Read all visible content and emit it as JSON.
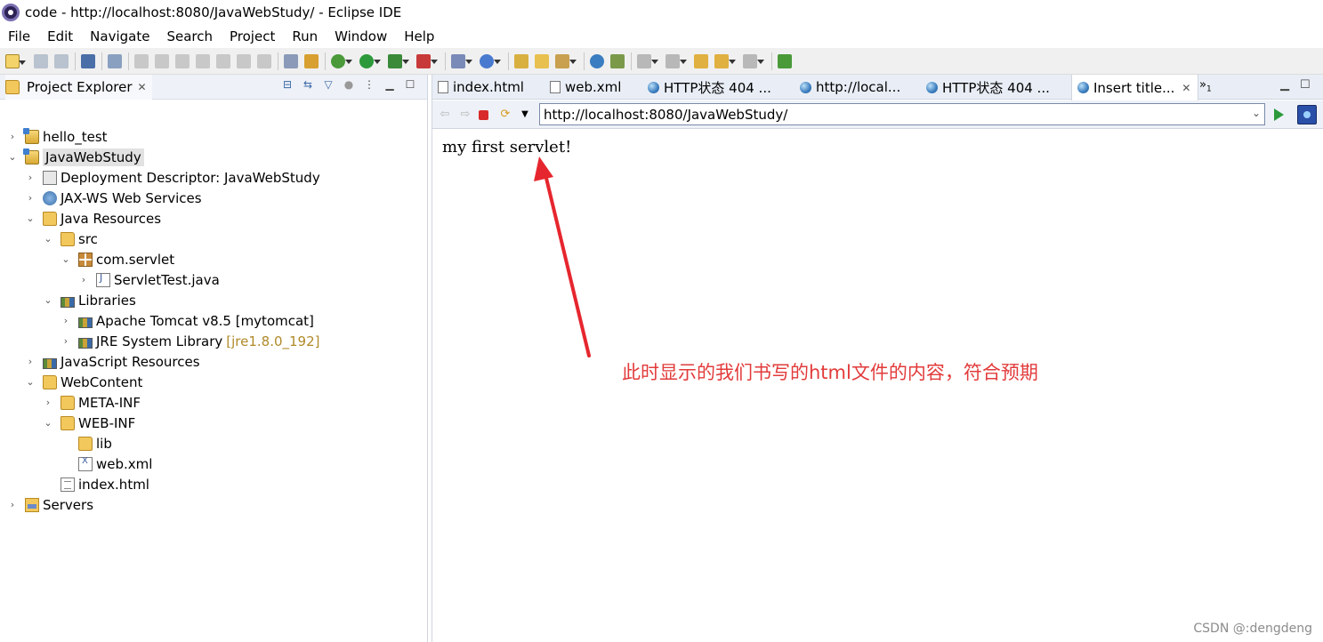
{
  "window": {
    "title": "code - http://localhost:8080/JavaWebStudy/ - Eclipse IDE"
  },
  "menu": [
    "File",
    "Edit",
    "Navigate",
    "Search",
    "Project",
    "Run",
    "Window",
    "Help"
  ],
  "project_explorer": {
    "title": "Project Explorer",
    "tree": [
      {
        "label": "hello_test",
        "icon": "project-icon",
        "expanded": false
      },
      {
        "label": "JavaWebStudy",
        "icon": "project-icon",
        "expanded": true,
        "selected": true
      },
      {
        "label": "Deployment Descriptor: JavaWebStudy",
        "icon": "deployment-descriptor-icon",
        "expanded": false
      },
      {
        "label": "JAX-WS Web Services",
        "icon": "web-services-icon",
        "expanded": false
      },
      {
        "label": "Java Resources",
        "icon": "java-resources-icon",
        "expanded": true
      },
      {
        "label": "src",
        "icon": "source-folder-icon",
        "expanded": true
      },
      {
        "label": "com.servlet",
        "icon": "package-icon",
        "expanded": true
      },
      {
        "label": "ServletTest.java",
        "icon": "java-file-icon",
        "expanded": false
      },
      {
        "label": "Libraries",
        "icon": "libraries-icon",
        "expanded": true
      },
      {
        "label": "Apache Tomcat v8.5 [mytomcat]",
        "icon": "library-icon",
        "expanded": false
      },
      {
        "label": "JRE System Library",
        "decoration": "[jre1.8.0_192]",
        "icon": "library-icon",
        "expanded": false
      },
      {
        "label": "JavaScript Resources",
        "icon": "libraries-icon",
        "expanded": false
      },
      {
        "label": "WebContent",
        "icon": "folder-icon",
        "expanded": true
      },
      {
        "label": "META-INF",
        "icon": "folder-icon",
        "expanded": false
      },
      {
        "label": "WEB-INF",
        "icon": "folder-icon",
        "expanded": true
      },
      {
        "label": "lib",
        "icon": "folder-icon"
      },
      {
        "label": "web.xml",
        "icon": "xml-file-icon"
      },
      {
        "label": "index.html",
        "icon": "html-file-icon"
      },
      {
        "label": "Servers",
        "icon": "servers-folder-icon",
        "expanded": false
      }
    ]
  },
  "editor_tabs": [
    {
      "label": "index.html",
      "icon": "html-file-icon"
    },
    {
      "label": "web.xml",
      "icon": "xml-file-icon"
    },
    {
      "label": "HTTP状态 404 ...",
      "icon": "globe-icon"
    },
    {
      "label": "http://local...",
      "icon": "globe-icon"
    },
    {
      "label": "HTTP状态 404 ...",
      "icon": "globe-icon"
    },
    {
      "label": "Insert title...",
      "icon": "globe-icon",
      "active": true
    }
  ],
  "tab_overflow": "»",
  "tab_overflow_count": "1",
  "browser": {
    "url": "http://localhost:8080/JavaWebStudy/",
    "page_text": "my first servlet!"
  },
  "annotation": {
    "text": "此时显示的我们书写的html文件的内容，符合预期",
    "color": "#e23b3b"
  },
  "watermark": "CSDN @:dengdeng"
}
